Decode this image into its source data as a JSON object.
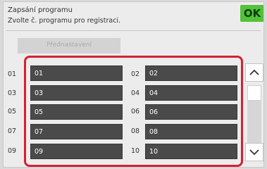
{
  "header": {
    "title": "Zapsání programu",
    "subtitle": "Zvolte č. programu pro registraci.",
    "ok_label": "OK"
  },
  "preset": {
    "label": "Přednastavení"
  },
  "slots": [
    {
      "num": "01",
      "label": "01"
    },
    {
      "num": "02",
      "label": "02"
    },
    {
      "num": "03",
      "label": "03"
    },
    {
      "num": "04",
      "label": "04"
    },
    {
      "num": "05",
      "label": "05"
    },
    {
      "num": "06",
      "label": "06"
    },
    {
      "num": "07",
      "label": "07"
    },
    {
      "num": "08",
      "label": "08"
    },
    {
      "num": "09",
      "label": "09"
    },
    {
      "num": "10",
      "label": "10"
    }
  ],
  "scroll": {
    "up_icon": "chevron-up-icon",
    "down_icon": "chevron-down-icon"
  },
  "colors": {
    "ok_green": "#53c23a",
    "highlight_red": "#d62030",
    "slot_dark": "#4a4a4a"
  }
}
